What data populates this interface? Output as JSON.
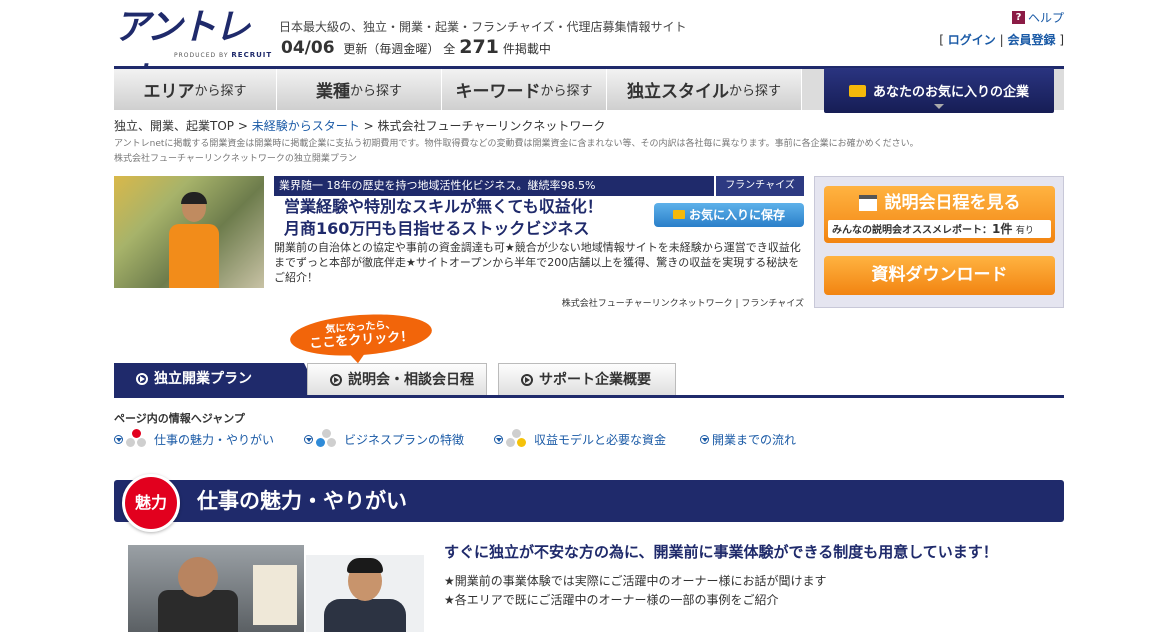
{
  "header": {
    "logo_main": "アントレ",
    "logo_net": "net",
    "logo_sub_prefix": "PRODUCED BY",
    "logo_sub_brand": "RECRUIT",
    "tagline": "日本最大級の、独立・開業・起業・フランチャイズ・代理店募集情報サイト",
    "update_date": "04/06",
    "update_text": "更新（毎週金曜）",
    "total_prefix": "全",
    "total_count": "271",
    "total_suffix": "件掲載中",
    "help_label": "ヘルプ",
    "help_icon": "?",
    "login_label": "ログイン",
    "register_label": "会員登録"
  },
  "nav": {
    "items": [
      {
        "main": "エリア",
        "sub": "から探す"
      },
      {
        "main": "業種",
        "sub": "から探す"
      },
      {
        "main": "キーワード",
        "sub": "から探す"
      },
      {
        "main": "独立スタイル",
        "sub": "から探す"
      }
    ],
    "favorites": "あなたのお気に入りの企業"
  },
  "breadcrumb": {
    "items": [
      "独立、開業、起業TOP",
      "未経験からスタート"
    ],
    "sep": ">",
    "current": "株式会社フューチャーリンクネットワーク"
  },
  "notes": {
    "line1": "アントレnetに掲載する開業資金は開業時に掲載企業に支払う初期費用です。物件取得費などの変動費は開業資金に含まれない等、その内訳は各社毎に異なります。事前に各企業にお確かめください。",
    "line2": "株式会社フューチャーリンクネットワークの独立開業プラン"
  },
  "promo": {
    "bar_text": "業界随一 18年の歴史を持つ地域活性化ビジネス。継続率98.5%",
    "kind": "フランチャイズ",
    "headline1": "営業経験や特別なスキルが無くても収益化！",
    "headline2": "月商160万円も目指せるストックビジネス",
    "save_button": "お気に入りに保存",
    "description": "開業前の自治体との協定や事前の資金調達も可★競合が少ない地域情報サイトを未経験から運営でき収益化までずっと本部が徹底伴走★サイトオープンから半年で200店舗以上を獲得、驚きの収益を実現する秘訣をご紹介！",
    "company_line": "株式会社フューチャーリンクネットワーク | フランチャイズ"
  },
  "side": {
    "schedule_button": "説明会日程を見る",
    "report_text": "みんなの説明会オススメレポート：",
    "report_count": "1件",
    "report_suffix": "有り",
    "download_button": "資料ダウンロード"
  },
  "bubble": {
    "line1": "気になったら、",
    "line2": "ここをクリック！"
  },
  "page_tabs": [
    "独立開業プラン",
    "説明会・相談会日程",
    "サポート企業概要"
  ],
  "jump": {
    "title": "ページ内の情報へジャンプ",
    "links": [
      "仕事の魅力・やりがい",
      "ビジネスプランの特徴",
      "収益モデルと必要な資金",
      "開業までの流れ"
    ]
  },
  "section": {
    "badge": "魅力",
    "title": "仕事の魅力・やりがい"
  },
  "content": {
    "lead": "すぐに独立が不安な方の為に、開業前に事業体験ができる制度も用意しています！",
    "bullet1": "★開業前の事業体験では実際にご活躍中のオーナー様にお話が聞けます",
    "bullet2": "★各エリアで既にご活躍中のオーナー様の一部の事例をご紹介"
  },
  "colors": {
    "navy": "#1f2a6b",
    "link": "#1a5aa6",
    "orange": "#f28411",
    "red": "#e2001e"
  }
}
